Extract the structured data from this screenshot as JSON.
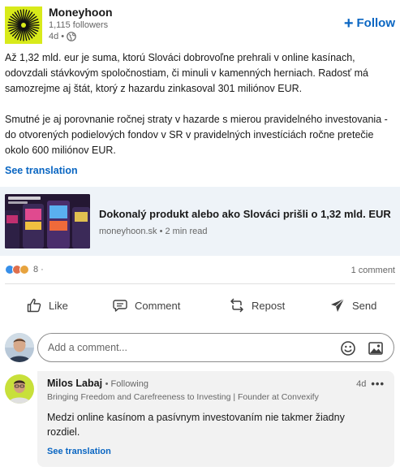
{
  "post": {
    "author": "Moneyhoon",
    "followers": "1,115 followers",
    "age": "4d •",
    "follow_label": "Follow",
    "follow_plus": "+",
    "paragraph1": "Až 1,32 mld. eur je suma, ktorú Slováci dobrovoľne prehrali v online kasínach, odovzdali stávkovým spoločnostiam, či minuli v kamenných herniach. Radosť má samozrejme aj štát, ktorý z hazardu zinkasoval 301 miliónov EUR.",
    "paragraph2": "Smutné je aj porovnanie ročnej straty v hazarde s mierou pravidelného investovania - do otvorených podielových fondov v SR v pravidelných investíciách ročne pretečie okolo 600 miliónov EUR.",
    "see_translation": "See translation"
  },
  "article": {
    "title": "Dokonalý produkt alebo ako Slováci prišli o 1,32 mld. EUR",
    "source": "moneyhoon.sk • 2 min read",
    "thumb_icon": "slot-machines-image"
  },
  "social": {
    "reaction_count": "8 ·",
    "comments": "1 comment",
    "reaction_colors": [
      "#378fe9",
      "#df704d",
      "#e7a33e"
    ]
  },
  "actions": {
    "like": "Like",
    "comment": "Comment",
    "repost": "Repost",
    "send": "Send"
  },
  "comment_box": {
    "placeholder": "Add a comment..."
  },
  "comment": {
    "name": "Milos Labaj",
    "following": "• Following",
    "headline": "Bringing Freedom and Carefreeness to Investing | Founder at Convexify",
    "time": "4d",
    "more": "•••",
    "text": "Medzi online kasínom a pasívnym investovaním nie takmer žiadny rozdiel.",
    "see_translation": "See translation"
  },
  "colors": {
    "accent": "#0a66c2",
    "logo_bg": "#d8ea1a"
  }
}
